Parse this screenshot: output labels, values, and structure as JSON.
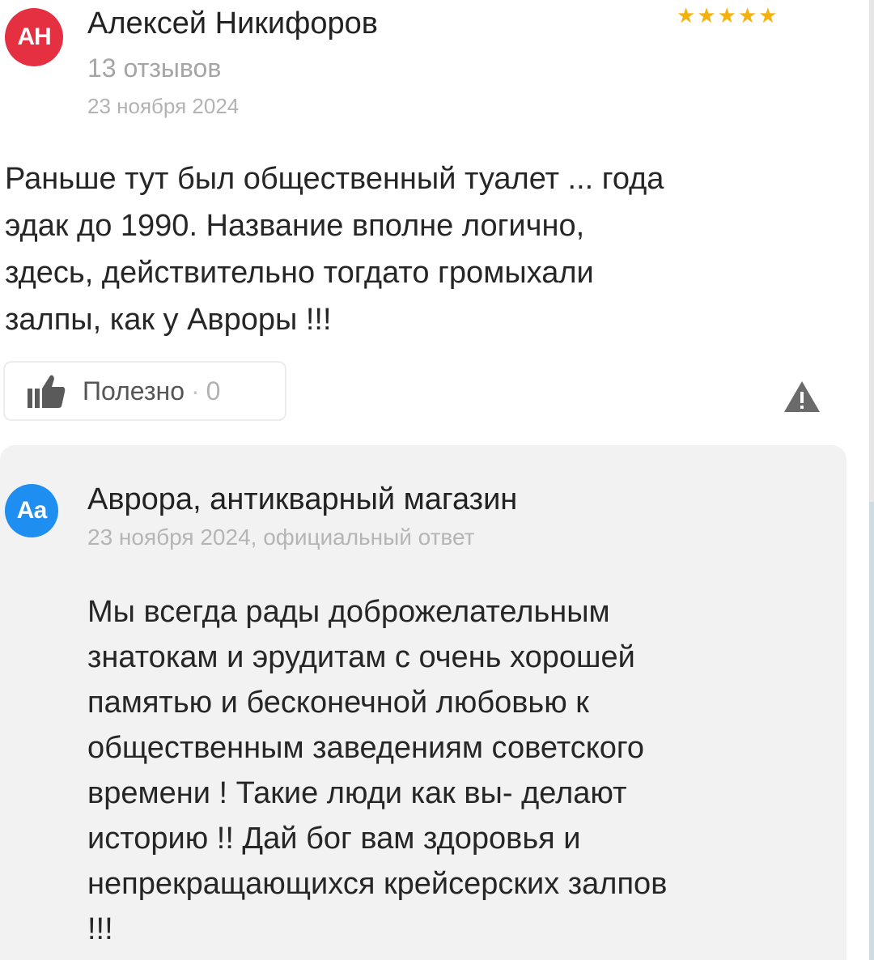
{
  "review": {
    "avatar_initials": "АН",
    "author_name": "Алексей Никифоров",
    "author_reviews": "13 отзывов",
    "date": "23 ноября 2024",
    "rating": 5,
    "stars": [
      "★",
      "★",
      "★",
      "★",
      "★"
    ],
    "text": "Раньше тут был общественный туалет ... года\nэдак до 1990. Название вполне логично,\nздесь, действительно тогдато громыхали\nзалпы, как у Авроры !!!",
    "useful_label": "Полезно",
    "useful_separator": "·",
    "useful_count": "0",
    "report_icon": "warning-icon"
  },
  "reply": {
    "avatar_initials": "Аа",
    "org_name": "Аврора, антикварный магазин",
    "meta": "23 ноября 2024, официальный ответ",
    "text": "Мы всегда рады доброжелательным\nзнатокам и эрудитам с очень хорошей\nпамятью и бесконечной любовью к\nобщественным заведениям советского\nвремени ! Такие люди как вы- делают\nисторию !! Дай бог вам здоровья и\nнепрекращающихся крейсерских залпов\n!!!"
  },
  "colors": {
    "user_avatar": "#e53042",
    "org_avatar": "#1f8ef1",
    "star": "#f4b10b",
    "reply_background": "#f2f2f2"
  }
}
